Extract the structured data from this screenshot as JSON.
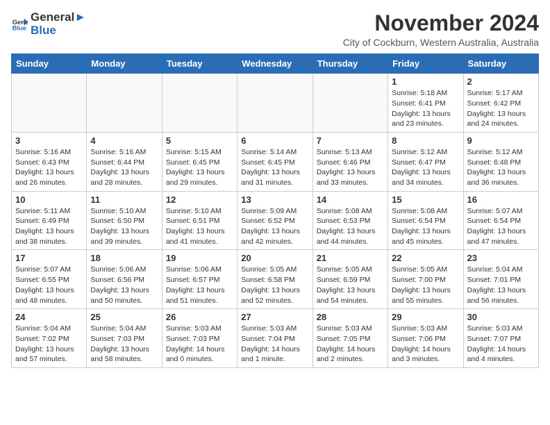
{
  "logo": {
    "text_general": "General",
    "text_blue": "Blue"
  },
  "title": "November 2024",
  "subtitle": "City of Cockburn, Western Australia, Australia",
  "weekdays": [
    "Sunday",
    "Monday",
    "Tuesday",
    "Wednesday",
    "Thursday",
    "Friday",
    "Saturday"
  ],
  "weeks": [
    [
      {
        "day": "",
        "info": ""
      },
      {
        "day": "",
        "info": ""
      },
      {
        "day": "",
        "info": ""
      },
      {
        "day": "",
        "info": ""
      },
      {
        "day": "",
        "info": ""
      },
      {
        "day": "1",
        "info": "Sunrise: 5:18 AM\nSunset: 6:41 PM\nDaylight: 13 hours and 23 minutes."
      },
      {
        "day": "2",
        "info": "Sunrise: 5:17 AM\nSunset: 6:42 PM\nDaylight: 13 hours and 24 minutes."
      }
    ],
    [
      {
        "day": "3",
        "info": "Sunrise: 5:16 AM\nSunset: 6:43 PM\nDaylight: 13 hours and 26 minutes."
      },
      {
        "day": "4",
        "info": "Sunrise: 5:16 AM\nSunset: 6:44 PM\nDaylight: 13 hours and 28 minutes."
      },
      {
        "day": "5",
        "info": "Sunrise: 5:15 AM\nSunset: 6:45 PM\nDaylight: 13 hours and 29 minutes."
      },
      {
        "day": "6",
        "info": "Sunrise: 5:14 AM\nSunset: 6:45 PM\nDaylight: 13 hours and 31 minutes."
      },
      {
        "day": "7",
        "info": "Sunrise: 5:13 AM\nSunset: 6:46 PM\nDaylight: 13 hours and 33 minutes."
      },
      {
        "day": "8",
        "info": "Sunrise: 5:12 AM\nSunset: 6:47 PM\nDaylight: 13 hours and 34 minutes."
      },
      {
        "day": "9",
        "info": "Sunrise: 5:12 AM\nSunset: 6:48 PM\nDaylight: 13 hours and 36 minutes."
      }
    ],
    [
      {
        "day": "10",
        "info": "Sunrise: 5:11 AM\nSunset: 6:49 PM\nDaylight: 13 hours and 38 minutes."
      },
      {
        "day": "11",
        "info": "Sunrise: 5:10 AM\nSunset: 6:50 PM\nDaylight: 13 hours and 39 minutes."
      },
      {
        "day": "12",
        "info": "Sunrise: 5:10 AM\nSunset: 6:51 PM\nDaylight: 13 hours and 41 minutes."
      },
      {
        "day": "13",
        "info": "Sunrise: 5:09 AM\nSunset: 6:52 PM\nDaylight: 13 hours and 42 minutes."
      },
      {
        "day": "14",
        "info": "Sunrise: 5:08 AM\nSunset: 6:53 PM\nDaylight: 13 hours and 44 minutes."
      },
      {
        "day": "15",
        "info": "Sunrise: 5:08 AM\nSunset: 6:54 PM\nDaylight: 13 hours and 45 minutes."
      },
      {
        "day": "16",
        "info": "Sunrise: 5:07 AM\nSunset: 6:54 PM\nDaylight: 13 hours and 47 minutes."
      }
    ],
    [
      {
        "day": "17",
        "info": "Sunrise: 5:07 AM\nSunset: 6:55 PM\nDaylight: 13 hours and 48 minutes."
      },
      {
        "day": "18",
        "info": "Sunrise: 5:06 AM\nSunset: 6:56 PM\nDaylight: 13 hours and 50 minutes."
      },
      {
        "day": "19",
        "info": "Sunrise: 5:06 AM\nSunset: 6:57 PM\nDaylight: 13 hours and 51 minutes."
      },
      {
        "day": "20",
        "info": "Sunrise: 5:05 AM\nSunset: 6:58 PM\nDaylight: 13 hours and 52 minutes."
      },
      {
        "day": "21",
        "info": "Sunrise: 5:05 AM\nSunset: 6:59 PM\nDaylight: 13 hours and 54 minutes."
      },
      {
        "day": "22",
        "info": "Sunrise: 5:05 AM\nSunset: 7:00 PM\nDaylight: 13 hours and 55 minutes."
      },
      {
        "day": "23",
        "info": "Sunrise: 5:04 AM\nSunset: 7:01 PM\nDaylight: 13 hours and 56 minutes."
      }
    ],
    [
      {
        "day": "24",
        "info": "Sunrise: 5:04 AM\nSunset: 7:02 PM\nDaylight: 13 hours and 57 minutes."
      },
      {
        "day": "25",
        "info": "Sunrise: 5:04 AM\nSunset: 7:03 PM\nDaylight: 13 hours and 58 minutes."
      },
      {
        "day": "26",
        "info": "Sunrise: 5:03 AM\nSunset: 7:03 PM\nDaylight: 14 hours and 0 minutes."
      },
      {
        "day": "27",
        "info": "Sunrise: 5:03 AM\nSunset: 7:04 PM\nDaylight: 14 hours and 1 minute."
      },
      {
        "day": "28",
        "info": "Sunrise: 5:03 AM\nSunset: 7:05 PM\nDaylight: 14 hours and 2 minutes."
      },
      {
        "day": "29",
        "info": "Sunrise: 5:03 AM\nSunset: 7:06 PM\nDaylight: 14 hours and 3 minutes."
      },
      {
        "day": "30",
        "info": "Sunrise: 5:03 AM\nSunset: 7:07 PM\nDaylight: 14 hours and 4 minutes."
      }
    ]
  ]
}
